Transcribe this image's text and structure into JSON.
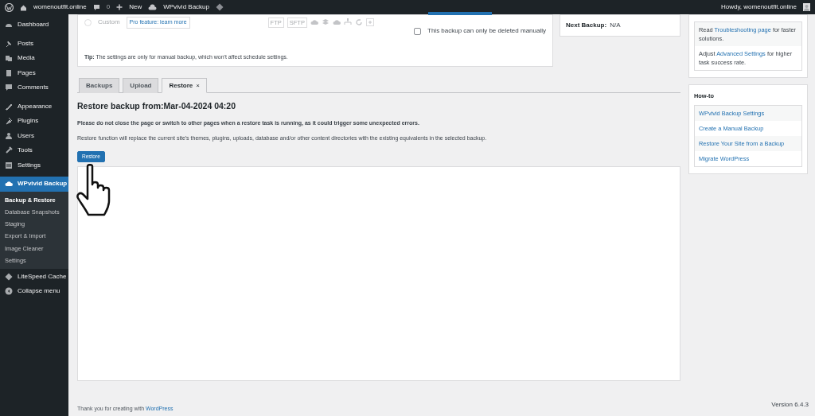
{
  "admin_bar": {
    "site": "womenoutfit.online",
    "comments": "0",
    "new": "New",
    "plugin": "WPvivid Backup",
    "greeting": "Howdy, womenoutfit.online"
  },
  "sidebar": {
    "groups": [
      {
        "items": [
          {
            "label": "Dashboard",
            "current": false
          }
        ]
      },
      {
        "items": [
          {
            "label": "Posts",
            "current": false
          },
          {
            "label": "Media",
            "current": false
          },
          {
            "label": "Pages",
            "current": false
          },
          {
            "label": "Comments",
            "current": false
          }
        ]
      },
      {
        "items": [
          {
            "label": "Appearance",
            "current": false
          },
          {
            "label": "Plugins",
            "current": false
          },
          {
            "label": "Users",
            "current": false
          },
          {
            "label": "Tools",
            "current": false
          },
          {
            "label": "Settings",
            "current": false
          }
        ]
      },
      {
        "items": [
          {
            "label": "WPvivid Backup",
            "current": true,
            "children": [
              {
                "label": "Backup & Restore",
                "selected": true
              },
              {
                "label": "Database Snapshots",
                "selected": false
              },
              {
                "label": "Staging",
                "selected": false
              },
              {
                "label": "Export & Import",
                "selected": false
              },
              {
                "label": "Image Cleaner",
                "selected": false
              },
              {
                "label": "Settings",
                "selected": false
              }
            ]
          },
          {
            "label": "LiteSpeed Cache",
            "current": false
          },
          {
            "label": "Collapse menu",
            "current": false
          }
        ]
      }
    ]
  },
  "backup_options": {
    "custom": {
      "label": "Custom",
      "checked": false,
      "disabled": true
    },
    "pro_link": "Pro feature: learn more",
    "storage_labels": [
      "FTP",
      "SFTP"
    ],
    "manual_delete": {
      "label": "This backup can only be deleted manually",
      "checked": false
    },
    "tip_label": "Tip:",
    "tip": "The settings are only for manual backup, which won't affect schedule settings."
  },
  "schedule": {
    "label": "Next Backup:",
    "value": "N/A"
  },
  "tabs": [
    {
      "label": "Backups",
      "selected": false,
      "closable": false
    },
    {
      "label": "Upload",
      "selected": false,
      "closable": false
    },
    {
      "label": "Restore",
      "selected": true,
      "closable": true
    }
  ],
  "tab_close": "×",
  "restore": {
    "title": "Restore backup from:Mar-04-2024 04:20",
    "warning": "Please do not close the page or switch to other pages when a restore task is running, as it could trigger some unexpected errors.",
    "description": "Restore function will replace the current site's themes, plugins, uploads, database and/or other content directories with the existing equivalents in the selected backup.",
    "button": "Restore"
  },
  "troubleshooting": [
    {
      "before": "Read ",
      "link": "Troubleshooting page",
      "after": " for faster solutions."
    },
    {
      "before": "Adjust ",
      "link": "Advanced Settings",
      "after": " for higher task success rate."
    }
  ],
  "howto": {
    "title": "How-to",
    "links": [
      "WPvivid Backup Settings",
      "Create a Manual Backup",
      "Restore Your Site from a Backup",
      "Migrate WordPress"
    ]
  },
  "footer": {
    "text": "Thank you for creating with ",
    "link": "WordPress",
    "version": "Version 6.4.3"
  }
}
